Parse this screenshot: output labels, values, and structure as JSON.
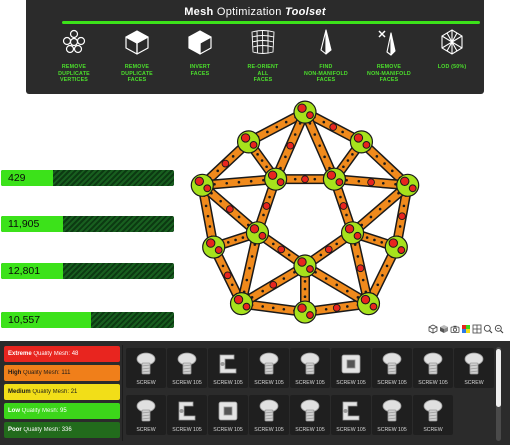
{
  "toolbar": {
    "title_bold": "Mesh",
    "title_regular": "Optimization",
    "title_italic": "Toolset",
    "tools": [
      {
        "label": "REMOVE\nDUPLICATE\nVERTICES",
        "icon": "vertex-cluster-icon"
      },
      {
        "label": "REMOVE\nDUPLICATE\nFACES",
        "icon": "duplicate-faces-cube-icon"
      },
      {
        "label": "INVERT\nFACES",
        "icon": "invert-faces-cube-icon"
      },
      {
        "label": "RE-ORIENT\nALL\nFACES",
        "icon": "reorient-grid-icon"
      },
      {
        "label": "FIND\nNON-MANIFOLD\nFACES",
        "icon": "non-manifold-find-icon"
      },
      {
        "label": "REMOVE\nNON-MANIFOLD\nFACES",
        "icon": "non-manifold-remove-icon"
      },
      {
        "label": "LOD (50%)",
        "icon": "lod-mesh-icon"
      }
    ]
  },
  "stats": [
    {
      "value": "429",
      "fill_fraction": 0.3
    },
    {
      "value": "11,905",
      "fill_fraction": 0.36
    },
    {
      "value": "12,801",
      "fill_fraction": 0.36
    },
    {
      "value": "10,557",
      "fill_fraction": 0.52
    }
  ],
  "viewport": {
    "model": "icosahedral-construction-kit-model",
    "colors": {
      "beam": "#f08a1c",
      "bolt": "#e8251f",
      "connector": "#a6e21c",
      "outline": "#1a1a1a"
    },
    "toolbar_icons": [
      "perspective-cube-icon",
      "shading-cube-icon",
      "camera-icon",
      "color-icon",
      "grid-icon",
      "zoom-icon",
      "zoom-fit-icon"
    ]
  },
  "quality": [
    {
      "bold": "Extreme",
      "label": "Quality Mesh:",
      "count": "48",
      "color": "#e8251f",
      "text_color": "#ffffff"
    },
    {
      "bold": "High",
      "label": "Quality Mesh:",
      "count": "111",
      "color": "#f07f1a",
      "text_color": "#1a1a1a"
    },
    {
      "bold": "Medium",
      "label": "Quality Mesh:",
      "count": "21",
      "color": "#f2de18",
      "text_color": "#1a1a1a"
    },
    {
      "bold": "Low",
      "label": "Quality Mesh:",
      "count": "95",
      "color": "#3cd61a",
      "text_color": "#ffffff"
    },
    {
      "bold": "Poor",
      "label": "Quality Mesh:",
      "count": "336",
      "color": "#226b1c",
      "text_color": "#ffffff"
    }
  ],
  "parts": [
    {
      "caption": "SCREW",
      "icon": "screw-icon",
      "selected": false
    },
    {
      "caption": "SCREW 105",
      "icon": "screw-icon",
      "selected": false
    },
    {
      "caption": "SCREW 105",
      "icon": "bracket-icon",
      "selected": false
    },
    {
      "caption": "SCREW 105",
      "icon": "screw-icon",
      "selected": false
    },
    {
      "caption": "SCREW 105",
      "icon": "screw-icon",
      "selected": false
    },
    {
      "caption": "SCREW 105",
      "icon": "nut-icon",
      "selected": false
    },
    {
      "caption": "SCREW 105",
      "icon": "screw-icon",
      "selected": false
    },
    {
      "caption": "SCREW 105",
      "icon": "screw-icon",
      "selected": false
    },
    {
      "caption": "SCREW",
      "icon": "screw-icon",
      "selected": false
    },
    {
      "caption": "SCREW",
      "icon": "screw-icon",
      "selected": false
    },
    {
      "caption": "SCREW 105",
      "icon": "bracket-icon",
      "selected": false
    },
    {
      "caption": "SCREW 105",
      "icon": "nut-icon",
      "selected": false
    },
    {
      "caption": "SCREW 105",
      "icon": "screw-icon",
      "selected": false
    },
    {
      "caption": "SCREW 105",
      "icon": "screw-icon",
      "selected": false
    },
    {
      "caption": "SCREW 105",
      "icon": "bracket-icon",
      "selected": false
    },
    {
      "caption": "SCREW 105",
      "icon": "screw-icon",
      "selected": false
    },
    {
      "caption": "SCREW",
      "icon": "screw-icon",
      "selected": false
    }
  ]
}
